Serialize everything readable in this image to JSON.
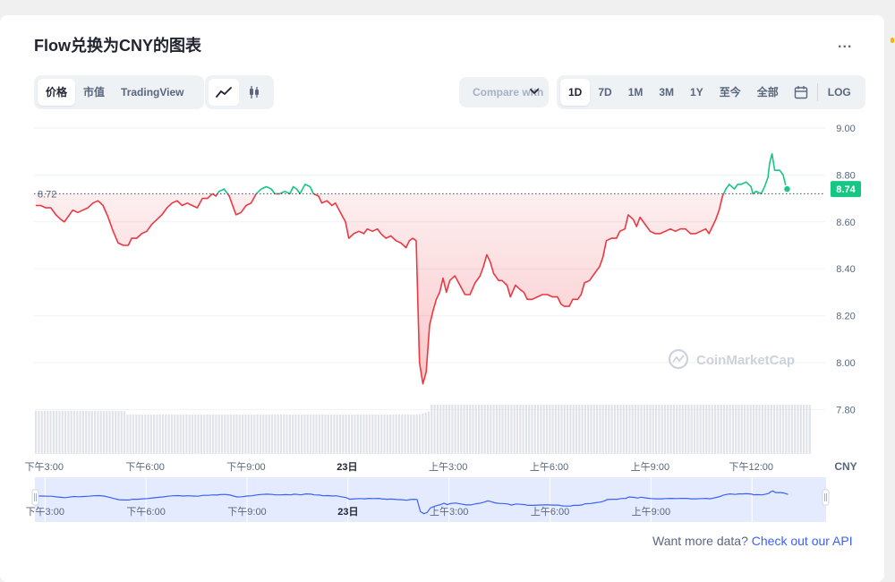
{
  "title": "Flow兑换为CNY的图表",
  "more_label": "...",
  "view_tabs": [
    "价格",
    "市值",
    "TradingView"
  ],
  "chart_style_icons": [
    "line-chart-icon",
    "candlestick-icon"
  ],
  "compare_label": "Compare with",
  "range_tabs": [
    "1D",
    "7D",
    "1M",
    "3M",
    "1Y",
    "至今",
    "全部"
  ],
  "calendar_icon": "calendar-icon",
  "log_label": "LOG",
  "watermark": "CoinMarketCap",
  "footer": {
    "text": "Want more data?",
    "link": "Check out our API"
  },
  "colors": {
    "up": "#16c784",
    "down": "#ea3943",
    "accent": "#3861fb",
    "text": "#222531",
    "muted": "#58667e"
  },
  "chart_data": {
    "type": "line",
    "currency": "CNY",
    "reference_price_label": "8.72",
    "reference_price": 8.72,
    "last_price_label": "8.74",
    "last_price": 8.74,
    "y_ticks": [
      "9.00",
      "8.80",
      "8.60",
      "8.40",
      "8.20",
      "8.00",
      "7.80"
    ],
    "ylim": [
      7.72,
      9.02
    ],
    "x_ticks": [
      "下午3:00",
      "下午6:00",
      "下午9:00",
      "23日",
      "上午3:00",
      "上午6:00",
      "上午9:00",
      "下午12:00"
    ],
    "x_hours": [
      0,
      3,
      6,
      9,
      12,
      15,
      18,
      21
    ],
    "x_start_hour": -0.3,
    "x_end_hour": 23.2,
    "grid": true,
    "series": [
      {
        "points": [
          [
            -0.25,
            8.67
          ],
          [
            -0.1,
            8.67
          ],
          [
            0.05,
            8.66
          ],
          [
            0.2,
            8.66
          ],
          [
            0.35,
            8.63
          ],
          [
            0.5,
            8.61
          ],
          [
            0.6,
            8.6
          ],
          [
            0.7,
            8.62
          ],
          [
            0.85,
            8.65
          ],
          [
            1.0,
            8.64
          ],
          [
            1.15,
            8.65
          ],
          [
            1.3,
            8.66
          ],
          [
            1.45,
            8.68
          ],
          [
            1.6,
            8.69
          ],
          [
            1.75,
            8.67
          ],
          [
            1.9,
            8.62
          ],
          [
            2.05,
            8.56
          ],
          [
            2.2,
            8.51
          ],
          [
            2.35,
            8.5
          ],
          [
            2.5,
            8.5
          ],
          [
            2.6,
            8.53
          ],
          [
            2.75,
            8.53
          ],
          [
            2.9,
            8.55
          ],
          [
            3.05,
            8.56
          ],
          [
            3.2,
            8.59
          ],
          [
            3.35,
            8.61
          ],
          [
            3.5,
            8.63
          ],
          [
            3.65,
            8.66
          ],
          [
            3.8,
            8.68
          ],
          [
            3.95,
            8.69
          ],
          [
            4.1,
            8.67
          ],
          [
            4.25,
            8.68
          ],
          [
            4.4,
            8.67
          ],
          [
            4.55,
            8.66
          ],
          [
            4.7,
            8.7
          ],
          [
            4.85,
            8.7
          ],
          [
            5.0,
            8.72
          ],
          [
            5.1,
            8.71
          ],
          [
            5.2,
            8.73
          ],
          [
            5.35,
            8.74
          ],
          [
            5.5,
            8.71
          ],
          [
            5.6,
            8.67
          ],
          [
            5.7,
            8.63
          ],
          [
            5.85,
            8.64
          ],
          [
            6.0,
            8.67
          ],
          [
            6.15,
            8.68
          ],
          [
            6.3,
            8.72
          ],
          [
            6.45,
            8.74
          ],
          [
            6.6,
            8.75
          ],
          [
            6.75,
            8.74
          ],
          [
            6.85,
            8.72
          ],
          [
            7.0,
            8.72
          ],
          [
            7.15,
            8.73
          ],
          [
            7.3,
            8.72
          ],
          [
            7.4,
            8.75
          ],
          [
            7.5,
            8.74
          ],
          [
            7.6,
            8.72
          ],
          [
            7.75,
            8.76
          ],
          [
            7.9,
            8.75
          ],
          [
            8.0,
            8.72
          ],
          [
            8.15,
            8.71
          ],
          [
            8.25,
            8.68
          ],
          [
            8.4,
            8.69
          ],
          [
            8.55,
            8.67
          ],
          [
            8.65,
            8.68
          ],
          [
            8.8,
            8.64
          ],
          [
            8.95,
            8.6
          ],
          [
            9.05,
            8.53
          ],
          [
            9.2,
            8.55
          ],
          [
            9.35,
            8.56
          ],
          [
            9.5,
            8.55
          ],
          [
            9.6,
            8.57
          ],
          [
            9.75,
            8.56
          ],
          [
            9.9,
            8.57
          ],
          [
            10.0,
            8.55
          ],
          [
            10.15,
            8.53
          ],
          [
            10.3,
            8.54
          ],
          [
            10.45,
            8.52
          ],
          [
            10.6,
            8.51
          ],
          [
            10.75,
            8.49
          ],
          [
            10.85,
            8.52
          ],
          [
            10.95,
            8.53
          ],
          [
            11.05,
            8.52
          ],
          [
            11.15,
            8.0
          ],
          [
            11.25,
            7.91
          ],
          [
            11.35,
            7.96
          ],
          [
            11.45,
            8.16
          ],
          [
            11.55,
            8.22
          ],
          [
            11.65,
            8.27
          ],
          [
            11.75,
            8.3
          ],
          [
            11.85,
            8.36
          ],
          [
            11.95,
            8.3
          ],
          [
            12.05,
            8.35
          ],
          [
            12.2,
            8.37
          ],
          [
            12.35,
            8.33
          ],
          [
            12.5,
            8.29
          ],
          [
            12.65,
            8.29
          ],
          [
            12.8,
            8.34
          ],
          [
            12.95,
            8.37
          ],
          [
            13.05,
            8.41
          ],
          [
            13.15,
            8.46
          ],
          [
            13.25,
            8.43
          ],
          [
            13.35,
            8.38
          ],
          [
            13.5,
            8.35
          ],
          [
            13.6,
            8.35
          ],
          [
            13.75,
            8.33
          ],
          [
            13.85,
            8.28
          ],
          [
            14.0,
            8.33
          ],
          [
            14.15,
            8.31
          ],
          [
            14.25,
            8.3
          ],
          [
            14.35,
            8.27
          ],
          [
            14.5,
            8.27
          ],
          [
            14.65,
            8.28
          ],
          [
            14.8,
            8.29
          ],
          [
            14.95,
            8.29
          ],
          [
            15.1,
            8.28
          ],
          [
            15.25,
            8.28
          ],
          [
            15.35,
            8.25
          ],
          [
            15.45,
            8.24
          ],
          [
            15.6,
            8.24
          ],
          [
            15.7,
            8.27
          ],
          [
            15.85,
            8.27
          ],
          [
            15.95,
            8.29
          ],
          [
            16.05,
            8.34
          ],
          [
            16.2,
            8.35
          ],
          [
            16.35,
            8.38
          ],
          [
            16.5,
            8.41
          ],
          [
            16.6,
            8.45
          ],
          [
            16.7,
            8.52
          ],
          [
            16.85,
            8.53
          ],
          [
            17.0,
            8.53
          ],
          [
            17.1,
            8.56
          ],
          [
            17.25,
            8.57
          ],
          [
            17.35,
            8.63
          ],
          [
            17.5,
            8.61
          ],
          [
            17.6,
            8.58
          ],
          [
            17.7,
            8.62
          ],
          [
            17.85,
            8.59
          ],
          [
            18.0,
            8.56
          ],
          [
            18.15,
            8.55
          ],
          [
            18.3,
            8.55
          ],
          [
            18.45,
            8.56
          ],
          [
            18.6,
            8.57
          ],
          [
            18.75,
            8.56
          ],
          [
            18.9,
            8.57
          ],
          [
            19.05,
            8.57
          ],
          [
            19.2,
            8.55
          ],
          [
            19.35,
            8.55
          ],
          [
            19.5,
            8.56
          ],
          [
            19.65,
            8.57
          ],
          [
            19.75,
            8.55
          ],
          [
            19.85,
            8.58
          ],
          [
            19.95,
            8.61
          ],
          [
            20.05,
            8.65
          ],
          [
            20.15,
            8.71
          ],
          [
            20.25,
            8.74
          ],
          [
            20.35,
            8.76
          ],
          [
            20.5,
            8.74
          ],
          [
            20.6,
            8.76
          ],
          [
            20.7,
            8.76
          ],
          [
            20.85,
            8.77
          ],
          [
            21.0,
            8.75
          ],
          [
            21.05,
            8.72
          ],
          [
            21.15,
            8.73
          ],
          [
            21.3,
            8.72
          ],
          [
            21.4,
            8.75
          ],
          [
            21.5,
            8.79
          ],
          [
            21.55,
            8.85
          ],
          [
            21.62,
            8.89
          ],
          [
            21.7,
            8.82
          ],
          [
            21.85,
            8.82
          ],
          [
            21.95,
            8.8
          ],
          [
            22.02,
            8.76
          ],
          [
            22.07,
            8.74
          ]
        ]
      }
    ]
  }
}
